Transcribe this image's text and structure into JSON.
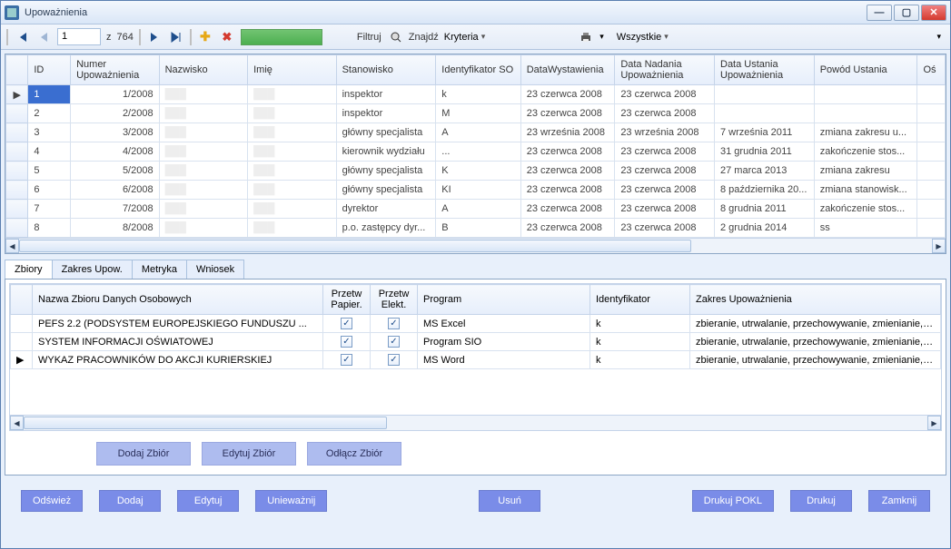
{
  "window": {
    "title": "Upoważnienia"
  },
  "toolbar": {
    "page_current": "1",
    "page_total_prefix": "z",
    "page_total": "764",
    "filter": "Filtruj",
    "find": "Znajdź",
    "criteria": "Kryteria",
    "scope": "Wszystkie"
  },
  "grid": {
    "headers": [
      "ID",
      "Numer Upoważnienia",
      "Nazwisko",
      "Imię",
      "Stanowisko",
      "Identyfikator SO",
      "DataWystawienia",
      "Data Nadania Upoważnienia",
      "Data Ustania Upoważnienia",
      "Powód Ustania",
      "Oś"
    ],
    "rows": [
      {
        "id": "1",
        "num": "1/2008",
        "nazw": "",
        "imie": "",
        "stan": "inspektor",
        "ident": "k",
        "dw": "23 czerwca 2008",
        "dn": "23 czerwca 2008",
        "du": "",
        "pu": ""
      },
      {
        "id": "2",
        "num": "2/2008",
        "nazw": "",
        "imie": "",
        "stan": "inspektor",
        "ident": "M",
        "dw": "23 czerwca 2008",
        "dn": "23 czerwca 2008",
        "du": "",
        "pu": ""
      },
      {
        "id": "3",
        "num": "3/2008",
        "nazw": "",
        "imie": "",
        "stan": "główny specjalista",
        "ident": "A",
        "dw": "23 września 2008",
        "dn": "23 września 2008",
        "du": "7 września 2011",
        "pu": "zmiana zakresu u..."
      },
      {
        "id": "4",
        "num": "4/2008",
        "nazw": "",
        "imie": "",
        "stan": "kierownik wydziału",
        "ident": "...",
        "dw": "23 czerwca 2008",
        "dn": "23 czerwca 2008",
        "du": "31 grudnia 2011",
        "pu": "zakończenie stos..."
      },
      {
        "id": "5",
        "num": "5/2008",
        "nazw": "",
        "imie": "",
        "stan": "główny specjalista",
        "ident": "K",
        "dw": "23 czerwca 2008",
        "dn": "23 czerwca 2008",
        "du": "27 marca 2013",
        "pu": "zmiana zakresu"
      },
      {
        "id": "6",
        "num": "6/2008",
        "nazw": "",
        "imie": "",
        "stan": "główny specjalista",
        "ident": "KI",
        "dw": "23 czerwca 2008",
        "dn": "23 czerwca 2008",
        "du": "8 października 20...",
        "pu": "zmiana stanowisk..."
      },
      {
        "id": "7",
        "num": "7/2008",
        "nazw": "",
        "imie": "",
        "stan": "dyrektor",
        "ident": "A",
        "dw": "23 czerwca 2008",
        "dn": "23 czerwca 2008",
        "du": "8 grudnia 2011",
        "pu": "zakończenie stos..."
      },
      {
        "id": "8",
        "num": "8/2008",
        "nazw": "",
        "imie": "",
        "stan": "p.o. zastępcy dyr...",
        "ident": "B",
        "dw": "23 czerwca 2008",
        "dn": "23 czerwca 2008",
        "du": "2 grudnia 2014",
        "pu": "ss"
      }
    ]
  },
  "tabs": {
    "t0": "Zbiory",
    "t1": "Zakres Upow.",
    "t2": "Metryka",
    "t3": "Wniosek"
  },
  "panel": {
    "headers": {
      "name": "Nazwa Zbioru Danych Osobowych",
      "pp": "Przetw Papier.",
      "pe": "Przetw Elekt.",
      "prog": "Program",
      "ident": "Identyfikator",
      "scope": "Zakres Upoważnienia"
    },
    "rows": [
      {
        "name": "PEFS 2.2 (PODSYSTEM EUROPEJSKIEGO FUNDUSZU ...",
        "prog": "MS Excel",
        "ident": "k",
        "scope": "zbieranie, utrwalanie, przechowywanie, zmienianie, udostę"
      },
      {
        "name": "SYSTEM INFORMACJI OŚWIATOWEJ",
        "prog": "Program SIO",
        "ident": "k",
        "scope": "zbieranie, utrwalanie, przechowywanie, zmienianie, udostę"
      },
      {
        "name": "WYKAZ PRACOWNIKÓW DO AKCJI KURIERSKIEJ",
        "prog": "MS Word",
        "ident": "k",
        "scope": "zbieranie, utrwalanie, przechowywanie, zmienianie, udostę"
      }
    ],
    "buttons": {
      "add": "Dodaj Zbiór",
      "edit": "Edytuj Zbiór",
      "detach": "Odłącz Zbiór"
    }
  },
  "bottom": {
    "refresh": "Odśwież",
    "add": "Dodaj",
    "edit": "Edytuj",
    "invalidate": "Unieważnij",
    "delete": "Usuń",
    "printpokl": "Drukuj POKL",
    "print": "Drukuj",
    "close": "Zamknij"
  }
}
